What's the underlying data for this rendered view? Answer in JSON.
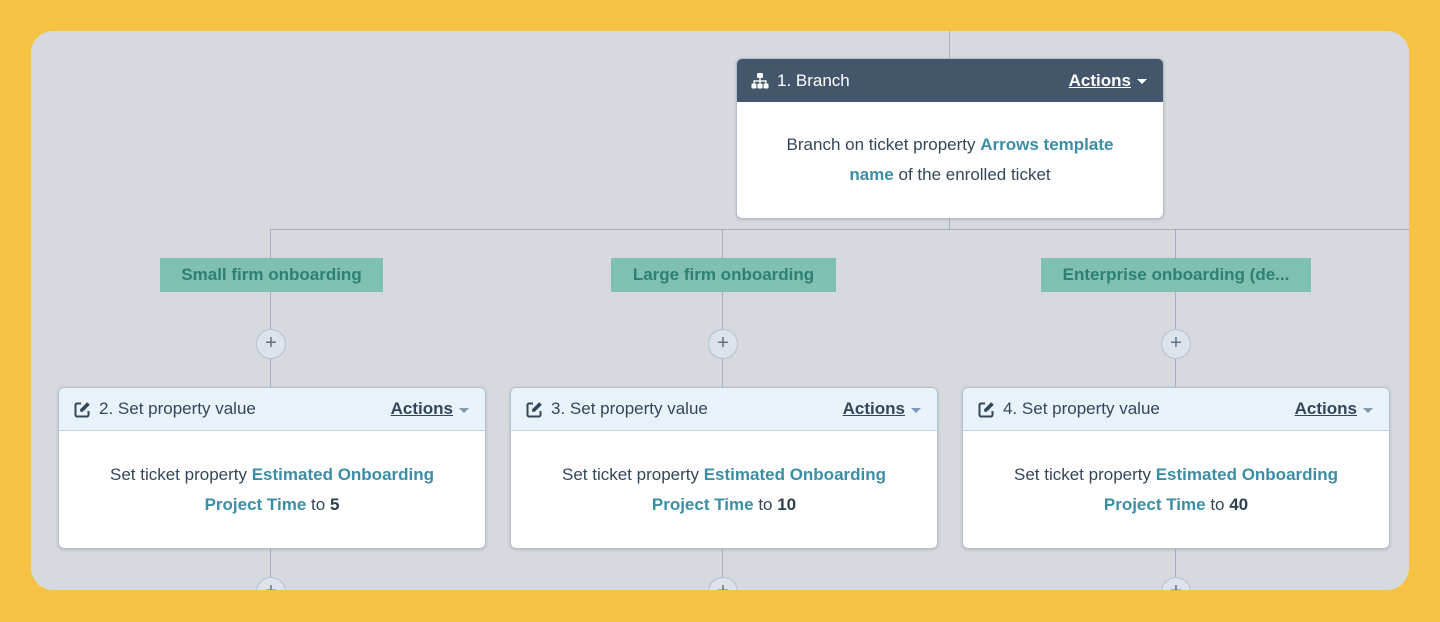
{
  "branch_card": {
    "title": "1. Branch",
    "actions": "Actions",
    "text_before": "Branch on ticket property ",
    "property_line1": "Arrows template",
    "property_line2": "name",
    "text_after": " of the enrolled ticket"
  },
  "branches": [
    {
      "label": "Small firm onboarding",
      "plus": "+",
      "card": {
        "title": "2. Set property value",
        "actions": "Actions",
        "text_before": "Set ticket property ",
        "property_line1": "Estimated Onboarding",
        "property_line2": "Project Time",
        "to": " to ",
        "value": "5"
      }
    },
    {
      "label": "Large firm onboarding",
      "plus": "+",
      "card": {
        "title": "3. Set property value",
        "actions": "Actions",
        "text_before": "Set ticket property ",
        "property_line1": "Estimated Onboarding",
        "property_line2": "Project Time",
        "to": " to ",
        "value": "10"
      }
    },
    {
      "label": "Enterprise onboarding (de...",
      "plus": "+",
      "card": {
        "title": "4. Set property value",
        "actions": "Actions",
        "text_before": "Set ticket property ",
        "property_line1": "Estimated Onboarding",
        "property_line2": "Project Time",
        "to": " to ",
        "value": "40"
      }
    }
  ],
  "bottom_plus": "+",
  "icons": {
    "branch": "branch-hierarchy-icon",
    "edit": "edit-square-icon",
    "dropdown": "caret-down-icon"
  },
  "colors": {
    "background": "#f6c243",
    "canvas": "#d6d9dd",
    "branch_header": "#44566c",
    "action_header": "#e8f2f9",
    "branch_label_bg": "#7fc0b3",
    "branch_label_text": "#2e8070",
    "link": "#3b8ea5"
  }
}
